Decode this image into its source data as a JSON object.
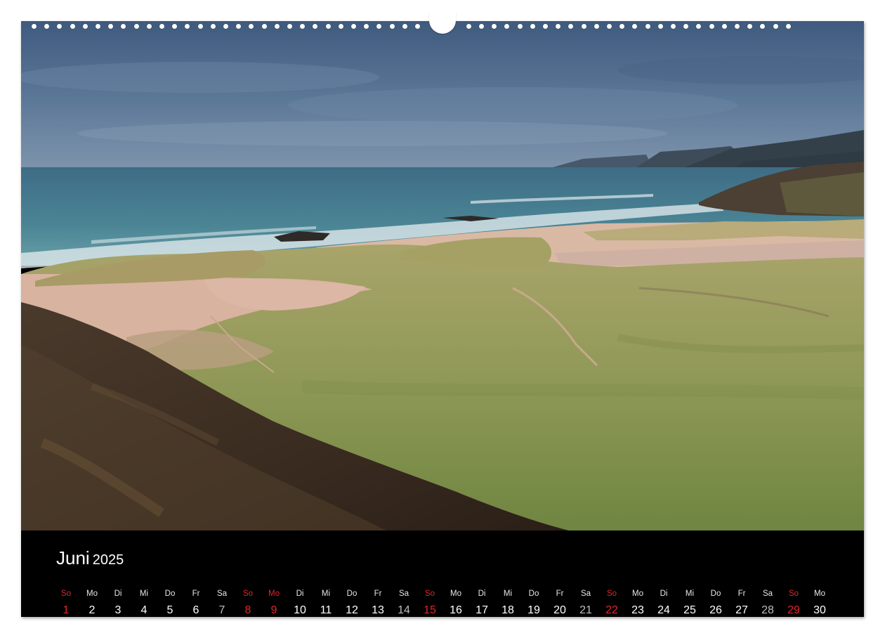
{
  "calendar": {
    "month": "Juni",
    "year": "2025",
    "days": [
      {
        "wd": "So",
        "d": "1",
        "type": "holiday"
      },
      {
        "wd": "Mo",
        "d": "2",
        "type": "normal"
      },
      {
        "wd": "Di",
        "d": "3",
        "type": "normal"
      },
      {
        "wd": "Mi",
        "d": "4",
        "type": "normal"
      },
      {
        "wd": "Do",
        "d": "5",
        "type": "normal"
      },
      {
        "wd": "Fr",
        "d": "6",
        "type": "normal"
      },
      {
        "wd": "Sa",
        "d": "7",
        "type": "saturday"
      },
      {
        "wd": "So",
        "d": "8",
        "type": "holiday"
      },
      {
        "wd": "Mo",
        "d": "9",
        "type": "holiday"
      },
      {
        "wd": "Di",
        "d": "10",
        "type": "normal"
      },
      {
        "wd": "Mi",
        "d": "11",
        "type": "normal"
      },
      {
        "wd": "Do",
        "d": "12",
        "type": "normal"
      },
      {
        "wd": "Fr",
        "d": "13",
        "type": "normal"
      },
      {
        "wd": "Sa",
        "d": "14",
        "type": "saturday"
      },
      {
        "wd": "So",
        "d": "15",
        "type": "holiday"
      },
      {
        "wd": "Mo",
        "d": "16",
        "type": "normal"
      },
      {
        "wd": "Di",
        "d": "17",
        "type": "normal"
      },
      {
        "wd": "Mi",
        "d": "18",
        "type": "normal"
      },
      {
        "wd": "Do",
        "d": "19",
        "type": "normal"
      },
      {
        "wd": "Fr",
        "d": "20",
        "type": "normal"
      },
      {
        "wd": "Sa",
        "d": "21",
        "type": "saturday"
      },
      {
        "wd": "So",
        "d": "22",
        "type": "holiday"
      },
      {
        "wd": "Mo",
        "d": "23",
        "type": "normal"
      },
      {
        "wd": "Di",
        "d": "24",
        "type": "normal"
      },
      {
        "wd": "Mi",
        "d": "25",
        "type": "normal"
      },
      {
        "wd": "Do",
        "d": "26",
        "type": "normal"
      },
      {
        "wd": "Fr",
        "d": "27",
        "type": "normal"
      },
      {
        "wd": "Sa",
        "d": "28",
        "type": "saturday"
      },
      {
        "wd": "So",
        "d": "29",
        "type": "holiday"
      },
      {
        "wd": "Mo",
        "d": "30",
        "type": "normal"
      }
    ]
  },
  "colors": {
    "holiday": "#e0262b",
    "saturday": "#bdbdbd",
    "background": "#000000",
    "text": "#ffffff"
  }
}
